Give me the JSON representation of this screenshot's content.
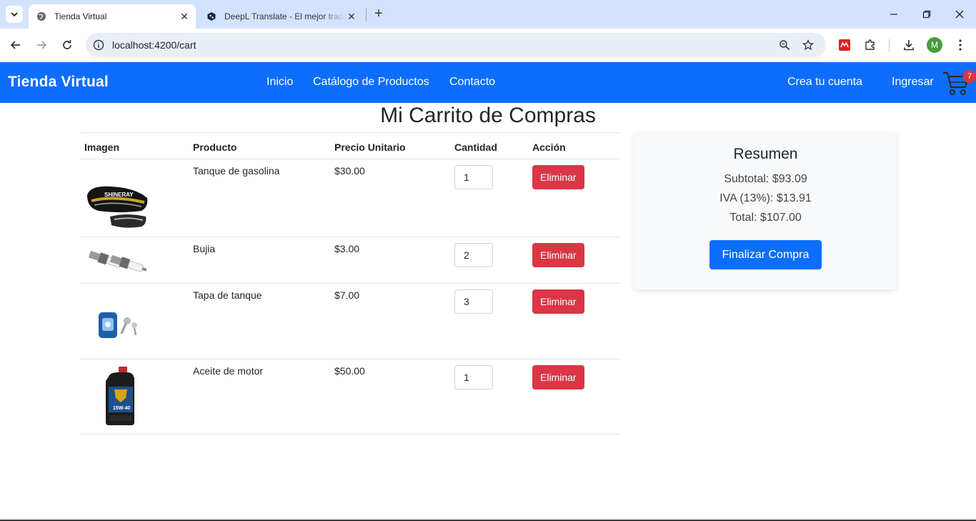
{
  "browser": {
    "tabs": [
      {
        "title": "Tienda Virtual",
        "active": true
      },
      {
        "title": "DeepL Translate - El mejor traductor",
        "active": false
      }
    ],
    "url": "localhost:4200/cart",
    "profile_initial": "M"
  },
  "navbar": {
    "brand": "Tienda Virtual",
    "links": [
      "Inicio",
      "Catálogo de Productos",
      "Contacto"
    ],
    "create_account": "Crea tu cuenta",
    "login": "Ingresar",
    "cart_count": "7",
    "color": "#0d6efd"
  },
  "page": {
    "title": "Mi Carrito de Compras"
  },
  "table": {
    "headers": [
      "Imagen",
      "Producto",
      "Precio Unitario",
      "Cantidad",
      "Acción"
    ],
    "rows": [
      {
        "product": "Tanque de gasolina",
        "price": "$30.00",
        "qty": "1",
        "action": "Eliminar",
        "image": "fuel-tank-image"
      },
      {
        "product": "Bujia",
        "price": "$3.00",
        "qty": "2",
        "action": "Eliminar",
        "image": "spark-plug-image"
      },
      {
        "product": "Tapa de tanque",
        "price": "$7.00",
        "qty": "3",
        "action": "Eliminar",
        "image": "tank-cap-image"
      },
      {
        "product": "Aceite de motor",
        "price": "$50.00",
        "qty": "1",
        "action": "Eliminar",
        "image": "motor-oil-image"
      }
    ]
  },
  "summary": {
    "title": "Resumen",
    "subtotal": "Subtotal: $93.09",
    "iva": "IVA (13%): $13.91",
    "total": "Total: $107.00",
    "checkout_label": "Finalizar Compra"
  },
  "colors": {
    "danger": "#dc3545",
    "primary": "#0d6efd"
  }
}
